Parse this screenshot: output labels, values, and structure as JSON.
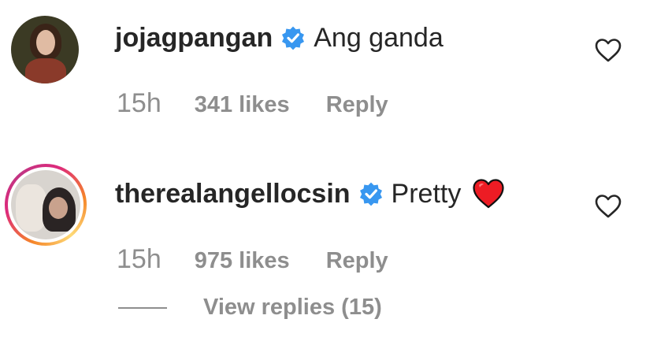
{
  "comments": [
    {
      "username": "jojagpangan",
      "text": "Ang ganda",
      "time": "15h",
      "likes": "341 likes",
      "reply_label": "Reply",
      "verified": true,
      "avatar_story_ring": false
    },
    {
      "username": "therealangellocsin",
      "text": "Pretty",
      "emoji": "red-heart-emoji",
      "time": "15h",
      "likes": "975 likes",
      "reply_label": "Reply",
      "verified": true,
      "avatar_story_ring": true,
      "view_replies": "View replies (15)"
    }
  ],
  "colors": {
    "primary_text": "#262626",
    "secondary_text": "#8e8e8e",
    "verified_blue": "#3897f0",
    "heart_red": "#ed1c24"
  },
  "icons": {
    "verified": "verified-badge-icon",
    "like": "heart-outline-icon"
  }
}
